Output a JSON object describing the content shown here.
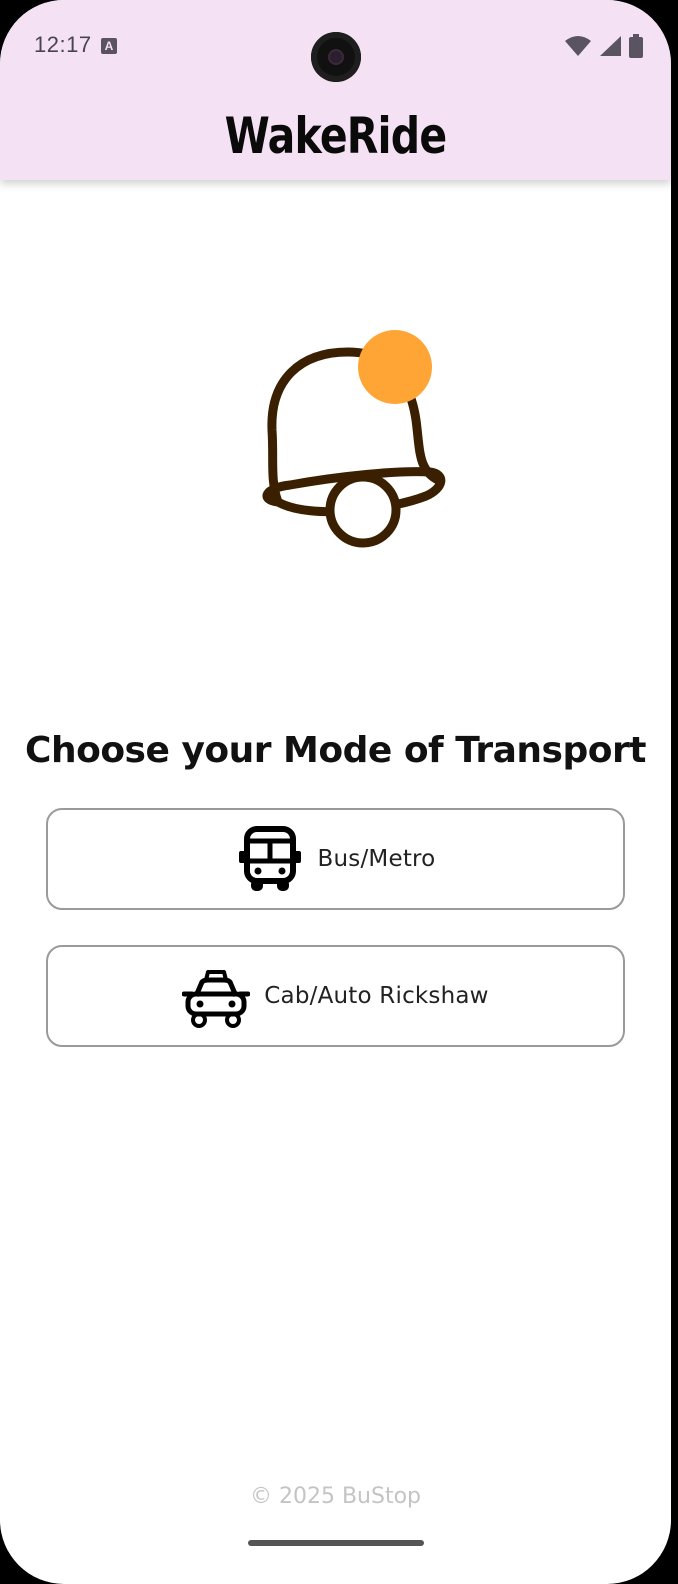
{
  "status_bar": {
    "time": "12:17",
    "notification_icon": "text-a-icon",
    "icons": [
      "wifi-icon",
      "signal-icon",
      "battery-icon"
    ]
  },
  "app_bar": {
    "title": "WakeRide",
    "background": "#f4e2f4"
  },
  "hero": {
    "icon": "bell-notification-icon",
    "bell_color": "#3a2000",
    "dot_color": "#ffa535"
  },
  "main": {
    "heading": "Choose your Mode of Transport",
    "options": [
      {
        "label": "Bus/Metro",
        "icon": "bus-icon"
      },
      {
        "label": "Cab/Auto Rickshaw",
        "icon": "taxi-icon"
      }
    ]
  },
  "footer": {
    "text": "© 2025 BuStop"
  }
}
